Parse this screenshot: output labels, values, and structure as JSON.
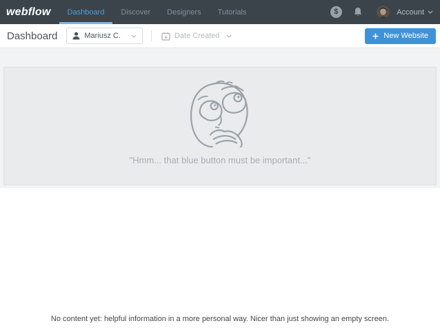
{
  "navbar": {
    "logo": "webflow",
    "items": [
      {
        "label": "Dashboard",
        "active": true
      },
      {
        "label": "Discover",
        "active": false
      },
      {
        "label": "Designers",
        "active": false
      },
      {
        "label": "Tutorials",
        "active": false
      }
    ],
    "billing_icon_glyph": "$",
    "account_label": "Account"
  },
  "toolbar": {
    "page_title": "Dashboard",
    "user_filter_value": "Mariusz C.",
    "date_sort_value": "Date Created",
    "new_website_button": "New Website"
  },
  "empty_state": {
    "quote": "\"Hmm... that blue button must be important...\""
  },
  "annotation": {
    "caption": "No content yet: helpful information in a more personal way. Nicer than just showing an empty screen."
  },
  "colors": {
    "navbar_bg": "#3b434b",
    "accent_blue": "#3e93d7",
    "active_link_blue": "#4f9fd8",
    "active_underline": "#7fb5dc",
    "canvas_gray": "#f2f3f4",
    "card_gray": "#e9ebec",
    "sketch_stroke": "#9ba2a9"
  }
}
